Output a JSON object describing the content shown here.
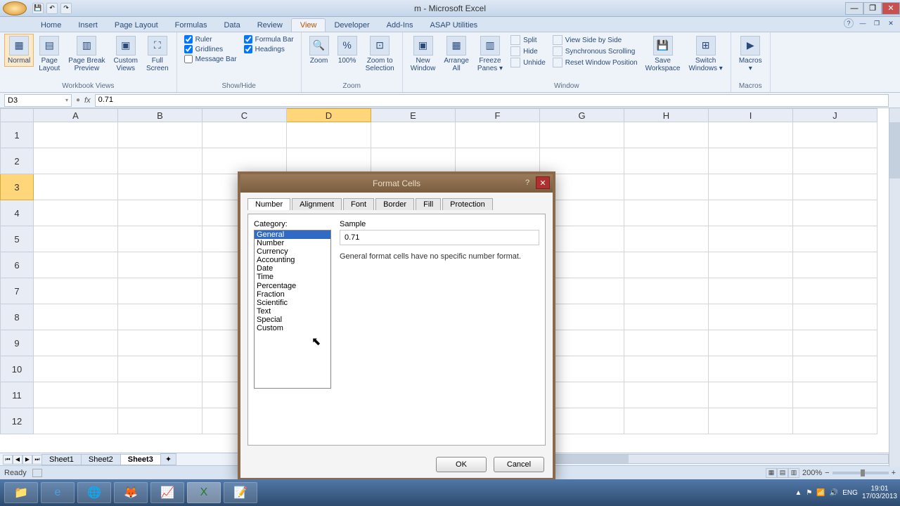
{
  "title": "m - Microsoft Excel",
  "qat": [
    "💾",
    "↶",
    "↷"
  ],
  "tabs": [
    "Home",
    "Insert",
    "Page Layout",
    "Formulas",
    "Data",
    "Review",
    "View",
    "Developer",
    "Add-Ins",
    "ASAP Utilities"
  ],
  "active_tab": "View",
  "ribbon": {
    "views": {
      "label": "Workbook Views",
      "normal": "Normal",
      "page_layout": "Page\nLayout",
      "page_break": "Page Break\nPreview",
      "custom": "Custom\nViews",
      "full": "Full\nScreen"
    },
    "showhide": {
      "label": "Show/Hide",
      "ruler": "Ruler",
      "gridlines": "Gridlines",
      "msgbar": "Message Bar",
      "fbar": "Formula Bar",
      "headings": "Headings"
    },
    "zoom": {
      "label": "Zoom",
      "zoom": "Zoom",
      "z100": "100%",
      "zsel": "Zoom to\nSelection"
    },
    "window": {
      "label": "Window",
      "new": "New\nWindow",
      "arrange": "Arrange\nAll",
      "freeze": "Freeze\nPanes ▾",
      "split": "Split",
      "hide": "Hide",
      "unhide": "Unhide",
      "sbs": "View Side by Side",
      "sync": "Synchronous Scrolling",
      "reset": "Reset Window Position",
      "save": "Save\nWorkspace",
      "switch": "Switch\nWindows ▾"
    },
    "macros": {
      "label": "Macros",
      "macros": "Macros\n▾"
    }
  },
  "namebox": "D3",
  "formula": "0.71",
  "columns": [
    "A",
    "B",
    "C",
    "D",
    "E",
    "F",
    "G",
    "H",
    "I",
    "J"
  ],
  "selected_col": "D",
  "rows": [
    "1",
    "2",
    "3",
    "4",
    "5",
    "6",
    "7",
    "8",
    "9",
    "10",
    "11",
    "12"
  ],
  "selected_row": "3",
  "sheets": [
    "Sheet1",
    "Sheet2",
    "Sheet3"
  ],
  "active_sheet": "Sheet3",
  "status": "Ready",
  "zoom_pct": "200%",
  "dialog": {
    "title": "Format Cells",
    "tabs": [
      "Number",
      "Alignment",
      "Font",
      "Border",
      "Fill",
      "Protection"
    ],
    "active_tab": "Number",
    "cat_label": "Category:",
    "categories": [
      "General",
      "Number",
      "Currency",
      "Accounting",
      "Date",
      "Time",
      "Percentage",
      "Fraction",
      "Scientific",
      "Text",
      "Special",
      "Custom"
    ],
    "selected_cat": "General",
    "sample_label": "Sample",
    "sample_value": "0.71",
    "description": "General format cells have no specific number format.",
    "ok": "OK",
    "cancel": "Cancel"
  },
  "tray": {
    "lang": "ENG",
    "time": "19:01",
    "date": "17/03/2013"
  }
}
